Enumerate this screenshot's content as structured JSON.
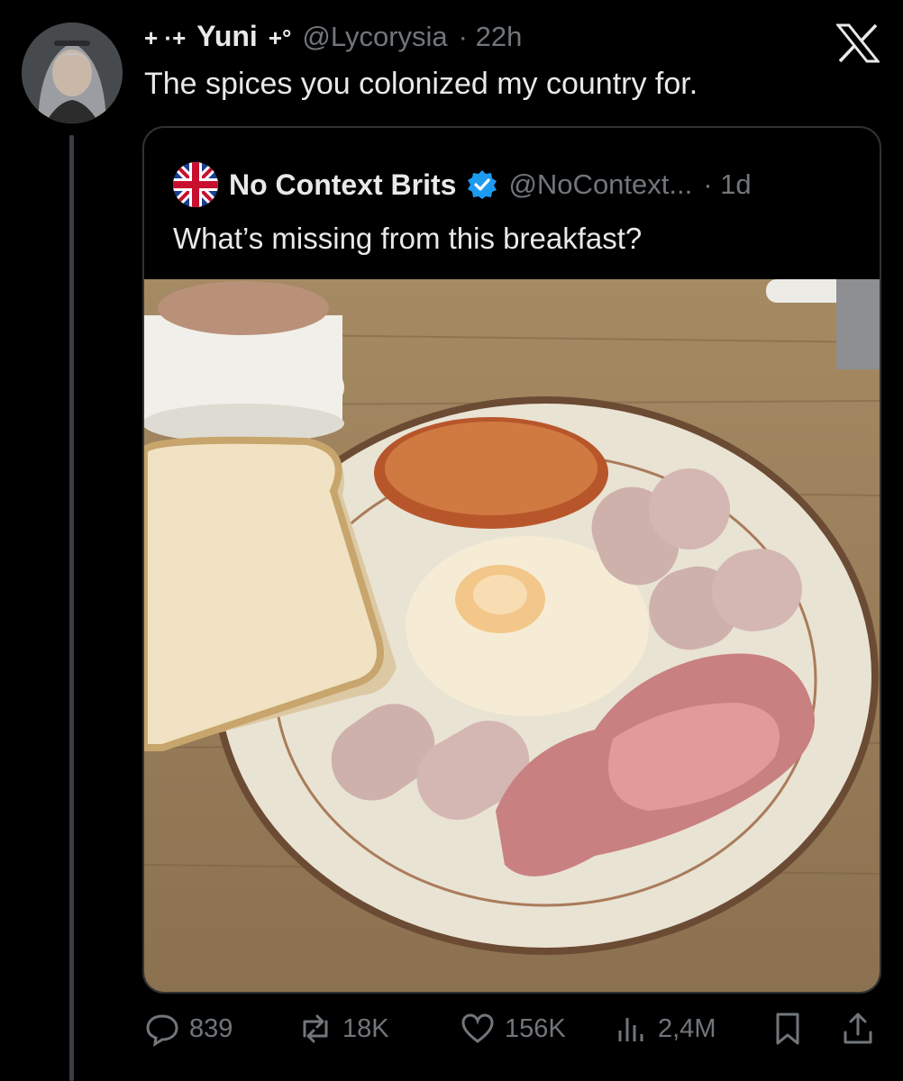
{
  "reply": {
    "prefix_deco": "+ ·+",
    "display_name": "Yuni",
    "suffix_deco": "+°",
    "handle": "@Lycorysia",
    "time": "· 22h",
    "text": "The spices you colonized my country for."
  },
  "quoted": {
    "display_name": "No Context Brits",
    "verified": true,
    "handle": "@NoContext...",
    "time": "· 1d",
    "text": "What’s missing from this breakfast?",
    "avatar_icon": "union-jack-flag-icon"
  },
  "actions": {
    "replies": "839",
    "reposts": "18K",
    "likes": "156K",
    "views": "2,4M"
  },
  "colors": {
    "background": "#000000",
    "text": "#e7e9ea",
    "muted": "#71767b",
    "border": "#2f3336",
    "verified": "#1d9bf0"
  }
}
